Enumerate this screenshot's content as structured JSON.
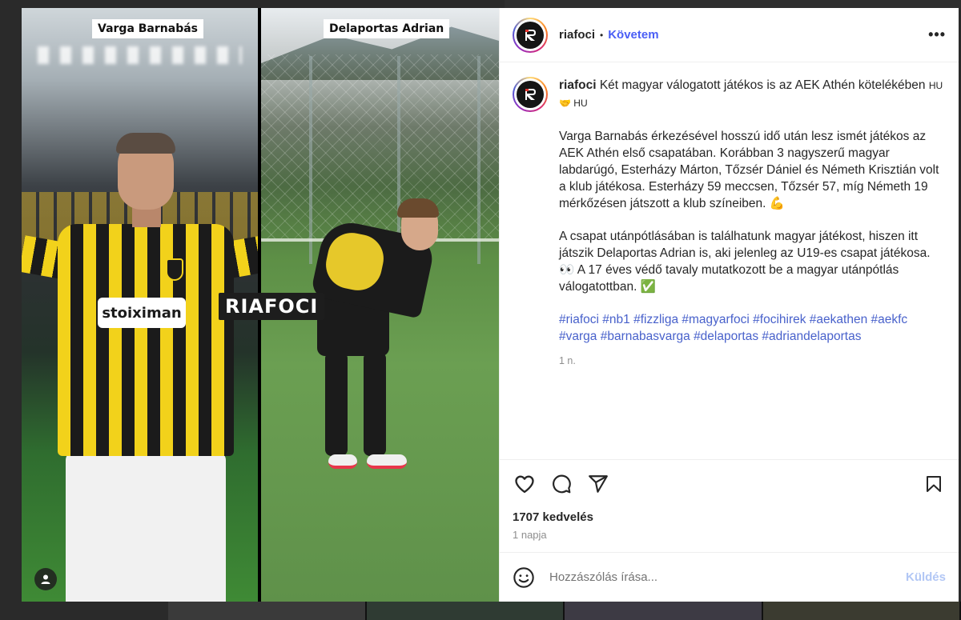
{
  "media": {
    "left_name": "Varga Barnabás",
    "right_name": "Delaportas Adrian",
    "watermark": "RIAFOCI",
    "sponsor_text": "stoiximan"
  },
  "header": {
    "username": "riafoci",
    "separator": "•",
    "follow_label": "Követem",
    "more_label": "•••"
  },
  "caption": {
    "username": "riafoci",
    "first_line": "Két magyar válogatott játékos is az AEK Athén kötelékében",
    "flags": "HU 🤝 HU",
    "paragraph1": "Varga Barnabás érkezésével hosszú idő után lesz ismét játékos az AEK Athén első csapatában. Korábban 3 nagyszerű magyar labdarúgó, Esterházy Márton, Tőzsér Dániel és Németh Krisztián volt a klub játékosa. Esterházy 59 meccsen, Tőzsér 57, míg Németh 19 mérkőzésen játszott a klub színeiben. 💪",
    "paragraph2": "A csapat utánpótlásában is találhatunk magyar játékost, hiszen itt játszik Delaportas Adrian is, aki jelenleg az U19-es csapat játékosa. 👀 A 17 éves védő tavaly mutatkozott be a magyar utánpótlás válogatottban. ✅",
    "hashtags": [
      "#riafoci",
      "#nb1",
      "#fizzliga",
      "#magyarfoci",
      "#focihirek",
      "#aekathen",
      "#aekfc",
      "#varga",
      "#barnabasvarga",
      "#delaportas",
      "#adriandelaportas"
    ],
    "time": "1 n."
  },
  "stats": {
    "likes": "1707 kedvelés",
    "date": "1 napja"
  },
  "comment": {
    "placeholder": "Hozzászólás írása...",
    "post_label": "Küldés"
  },
  "icons": {
    "like": "heart-icon",
    "comment": "comment-icon",
    "share": "share-icon",
    "save": "bookmark-icon",
    "emoji": "emoji-icon",
    "user": "user-icon"
  },
  "colors": {
    "accent": "#4a5ef5",
    "hashtag": "#4861cb",
    "post_disabled": "#b2c7f5"
  }
}
